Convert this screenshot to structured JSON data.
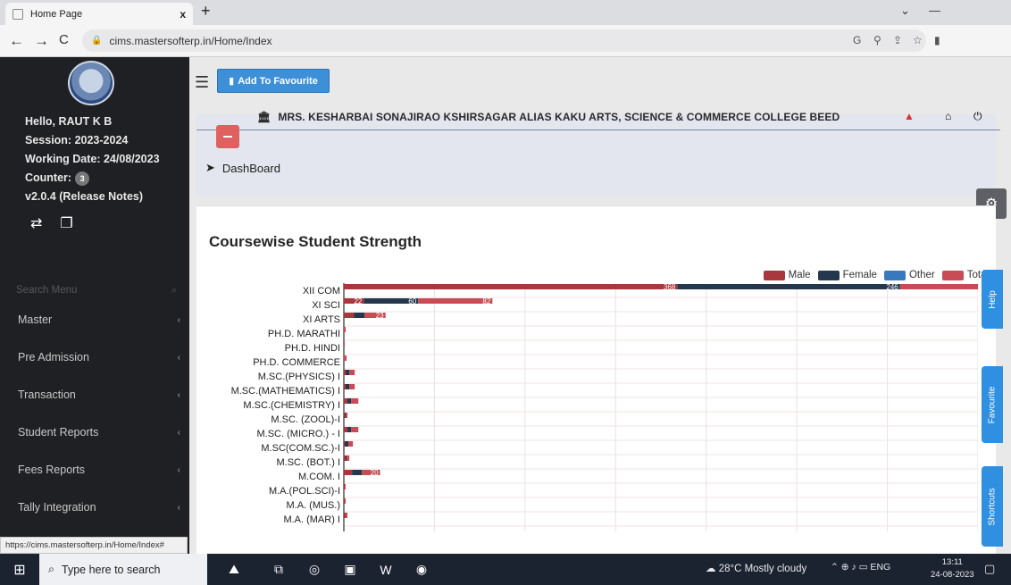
{
  "browser": {
    "tab_title": "Home Page",
    "tab_close": "x",
    "new_tab": "+",
    "url": "cims.mastersofterp.in/Home/Index",
    "min": "—",
    "dropdown": "⌄"
  },
  "sidebar": {
    "greeting": "Hello, RAUT K B",
    "session": "Session: 2023-2024",
    "working_date": "Working Date: 24/08/2023",
    "counter_label": "Counter:",
    "counter_value": "3",
    "version": "v2.0.4 (Release Notes)",
    "search_placeholder": "Search Menu",
    "items": [
      {
        "label": "Master"
      },
      {
        "label": "Pre Admission"
      },
      {
        "label": "Transaction"
      },
      {
        "label": "Student Reports"
      },
      {
        "label": "Fees Reports"
      },
      {
        "label": "Tally Integration"
      }
    ],
    "status_url": "https://cims.mastersofterp.in/Home/Index#"
  },
  "header": {
    "add_favourite": "Add To Favourite",
    "college_name": "MRS. KESHARBAI SONAJIRAO KSHIRSAGAR ALIAS KAKU ARTS, SCIENCE & COMMERCE COLLEGE BEED",
    "dashboard": "DashBoard"
  },
  "side_tabs": {
    "help": "Help",
    "favourite": "Favourite",
    "shortcuts": "Shortcuts"
  },
  "colors": {
    "male": "#a8383d",
    "female": "#25374d",
    "other": "#3a78bd",
    "total": "#c84b55"
  },
  "chart_data": {
    "type": "bar",
    "orientation": "horizontal",
    "stacked": true,
    "title": "Coursewise Student Strength",
    "legend": [
      "Male",
      "Female",
      "Other",
      "Total"
    ],
    "legend_position": "top-right",
    "categories": [
      "XII COM",
      "XI SCI",
      "XI ARTS",
      "PH.D. MARATHI",
      "PH.D. HINDI",
      "PH.D. COMMERCE",
      "M.SC.(PHYSICS) I",
      "M.SC.(MATHEMATICS) I",
      "M.SC.(CHEMISTRY) I",
      "M.SC. (ZOOL)-I",
      "M.SC. (MICRO.) - I",
      "M.SC(COM.SC.)-I",
      "M.SC. (BOT.) I",
      "M.COM. I",
      "M.A.(POL.SCI)-I",
      "M.A. (MUS.)",
      "M.A. (MAR) I"
    ],
    "series": [
      {
        "name": "Male",
        "values": [
          368,
          22,
          11,
          0,
          0,
          0,
          2,
          2,
          4,
          1,
          4,
          1,
          2,
          9,
          1,
          1,
          2
        ]
      },
      {
        "name": "Female",
        "values": [
          246,
          60,
          12,
          0,
          0,
          0,
          4,
          4,
          4,
          1,
          4,
          4,
          1,
          11,
          0,
          0,
          0
        ]
      },
      {
        "name": "Other",
        "values": [
          0,
          0,
          0,
          0,
          0,
          0,
          0,
          0,
          0,
          0,
          0,
          0,
          0,
          0,
          0,
          0,
          0
        ]
      },
      {
        "name": "Total",
        "values": [
          614,
          82,
          23,
          2,
          1,
          3,
          6,
          6,
          8,
          2,
          8,
          5,
          3,
          20,
          1,
          1,
          2
        ]
      }
    ],
    "xlim": [
      0,
      700
    ],
    "grid": true
  }
}
